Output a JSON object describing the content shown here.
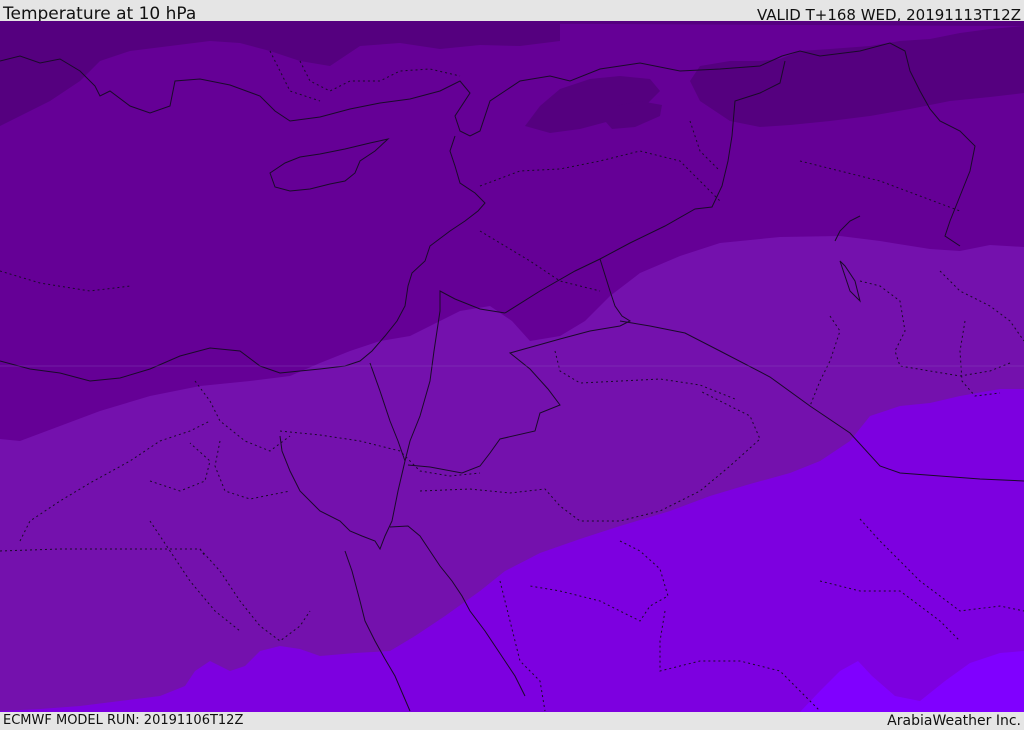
{
  "header": {
    "title": "Temperature at 10 hPa",
    "valid": "VALID T+168 WED, 20191113T12Z"
  },
  "footer": {
    "model_run": "ECMWF MODEL RUN: 20191106T12Z",
    "credit": "ArabiaWeather Inc."
  },
  "colors": {
    "band_darkest": "#55007f",
    "band_dark": "#650096",
    "band_mid": "#7411ad",
    "band_bright": "#7d00e0",
    "band_brightest": "#8000ff",
    "lines": "#1a0a2a"
  }
}
